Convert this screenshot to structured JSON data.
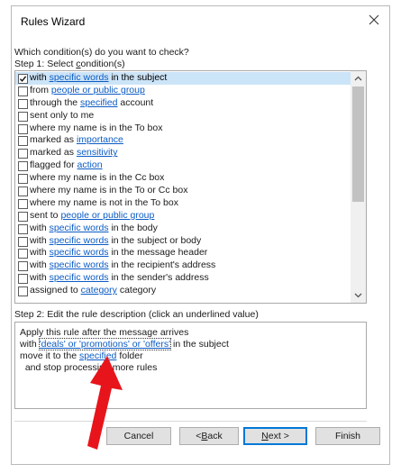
{
  "window": {
    "title": "Rules Wizard"
  },
  "step1": {
    "question": "Which condition(s) do you want to check?",
    "label_pre": "Step 1: Select ",
    "label_u": "c",
    "label_post": "ondition(s)"
  },
  "conditions": [
    {
      "checked": true,
      "selected": true,
      "pre": "with ",
      "link": "specific words",
      "post": " in the subject"
    },
    {
      "checked": false,
      "selected": false,
      "pre": "from ",
      "link": "people or public group",
      "post": ""
    },
    {
      "checked": false,
      "selected": false,
      "pre": "through the ",
      "link": "specified",
      "post": " account"
    },
    {
      "checked": false,
      "selected": false,
      "pre": "sent only to me",
      "link": "",
      "post": ""
    },
    {
      "checked": false,
      "selected": false,
      "pre": "where my name is in the To box",
      "link": "",
      "post": ""
    },
    {
      "checked": false,
      "selected": false,
      "pre": "marked as ",
      "link": "importance",
      "post": ""
    },
    {
      "checked": false,
      "selected": false,
      "pre": "marked as ",
      "link": "sensitivity",
      "post": ""
    },
    {
      "checked": false,
      "selected": false,
      "pre": "flagged for ",
      "link": "action",
      "post": ""
    },
    {
      "checked": false,
      "selected": false,
      "pre": "where my name is in the Cc box",
      "link": "",
      "post": ""
    },
    {
      "checked": false,
      "selected": false,
      "pre": "where my name is in the To or Cc box",
      "link": "",
      "post": ""
    },
    {
      "checked": false,
      "selected": false,
      "pre": "where my name is not in the To box",
      "link": "",
      "post": ""
    },
    {
      "checked": false,
      "selected": false,
      "pre": "sent to ",
      "link": "people or public group",
      "post": ""
    },
    {
      "checked": false,
      "selected": false,
      "pre": "with ",
      "link": "specific words",
      "post": " in the body"
    },
    {
      "checked": false,
      "selected": false,
      "pre": "with ",
      "link": "specific words",
      "post": " in the subject or body"
    },
    {
      "checked": false,
      "selected": false,
      "pre": "with ",
      "link": "specific words",
      "post": " in the message header"
    },
    {
      "checked": false,
      "selected": false,
      "pre": "with ",
      "link": "specific words",
      "post": " in the recipient's address"
    },
    {
      "checked": false,
      "selected": false,
      "pre": "with ",
      "link": "specific words",
      "post": " in the sender's address"
    },
    {
      "checked": false,
      "selected": false,
      "pre": "assigned to ",
      "link": "category",
      "post": " category"
    }
  ],
  "step2": {
    "label": "Step 2: Edit the rule description (click an underlined value)",
    "line1": "Apply this rule after the message arrives",
    "line2_pre": "with ",
    "line2_link": "'deals' or 'promotions' or 'offers'",
    "line2_post": " in the subject",
    "line3_pre": "move it to the ",
    "line3_link": "specified",
    "line3_post": " folder",
    "line4": "  and stop processing more rules"
  },
  "buttons": {
    "cancel": "Cancel",
    "back_pre": "< ",
    "back_u": "B",
    "back_post": "ack",
    "next_u": "N",
    "next_post": "ext >",
    "finish": "Finish"
  },
  "colors": {
    "link": "#0b5bc4",
    "selection": "#cce4f7",
    "default_button_border": "#0078d7",
    "annotation_arrow": "#e8141b"
  },
  "icons": {
    "close": "close-icon",
    "checkbox_check": "checkmark-icon",
    "scroll_up": "scroll-up-arrow-icon",
    "scroll_down": "scroll-down-arrow-icon",
    "annotation": "red-arrow-annotation"
  }
}
